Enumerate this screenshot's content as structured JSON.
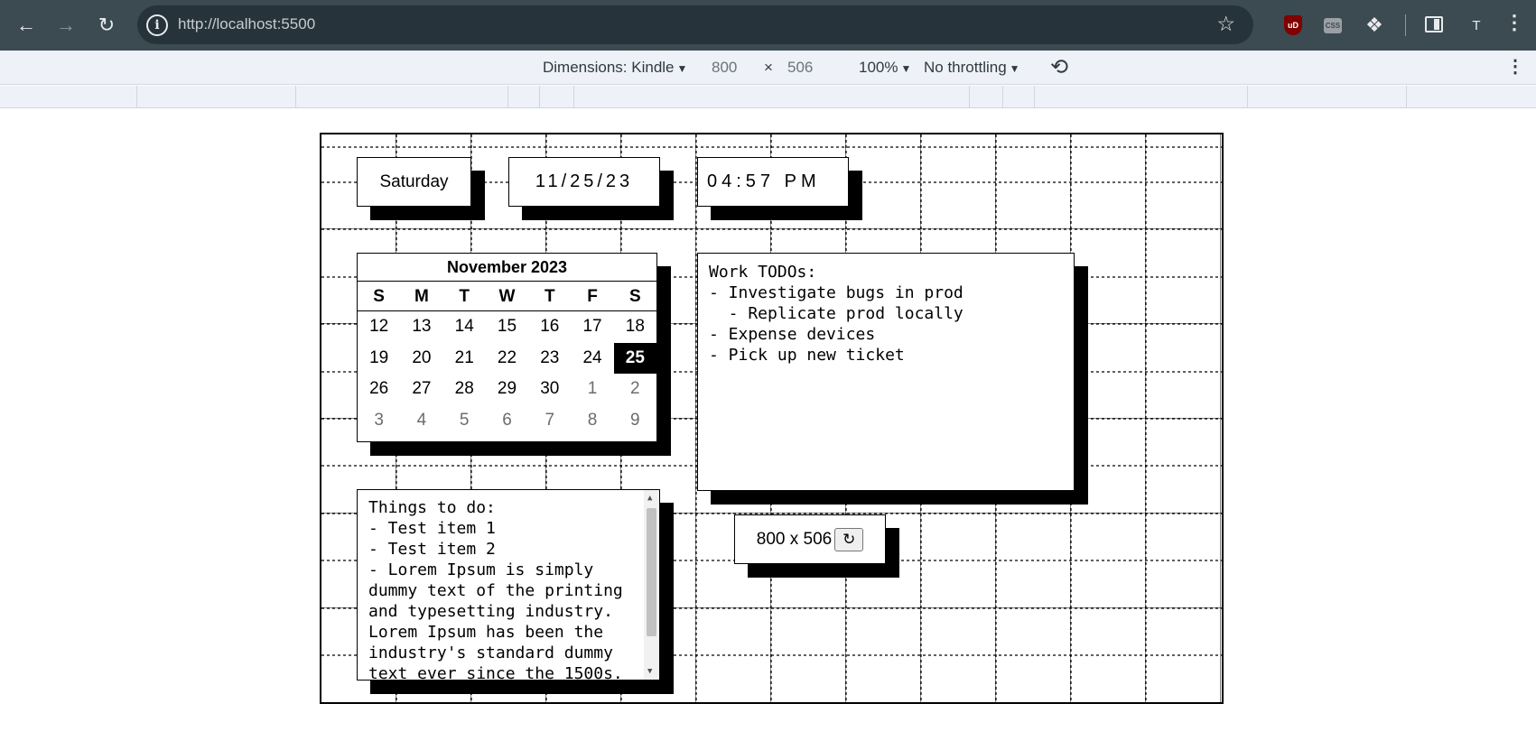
{
  "browser": {
    "url": "http://localhost:5500",
    "back_icon": "arrow-left-icon",
    "forward_icon": "arrow-right-icon",
    "reload_icon": "reload-icon",
    "site_info_icon": "info-icon",
    "bookmark_icon": "star-icon",
    "extensions": [
      "ublock-icon",
      "css-icon",
      "puzzle-icon"
    ],
    "profile_initial": "T"
  },
  "device_toolbar": {
    "dimensions_label": "Dimensions: Kindle",
    "width": "800",
    "times": "×",
    "height": "506",
    "zoom": "100%",
    "throttling": "No throttling"
  },
  "app": {
    "day": "Saturday",
    "date": "11/25/23",
    "time": "04:57 PM",
    "calendar": {
      "title": "November 2023",
      "weekdays": [
        "S",
        "M",
        "T",
        "W",
        "T",
        "F",
        "S"
      ],
      "weeks": [
        [
          "12",
          "13",
          "14",
          "15",
          "16",
          "17",
          "18"
        ],
        [
          "19",
          "20",
          "21",
          "22",
          "23",
          "24",
          "25"
        ],
        [
          "26",
          "27",
          "28",
          "29",
          "30",
          "1",
          "2"
        ],
        [
          "3",
          "4",
          "5",
          "6",
          "7",
          "8",
          "9"
        ]
      ],
      "today": "25"
    },
    "work_todos": "Work TODOs:\n- Investigate bugs in prod\n  - Replicate prod locally\n- Expense devices\n- Pick up new ticket",
    "things_todo": "Things to do:\n- Test item 1\n- Test item 2\n- Lorem Ipsum is simply\ndummy text of the printing\nand typesetting industry.\nLorem Ipsum has been the\nindustry's standard dummy\ntext ever since the 1500s.",
    "size_display": "800 x 506",
    "refresh_symbol": "↻"
  }
}
